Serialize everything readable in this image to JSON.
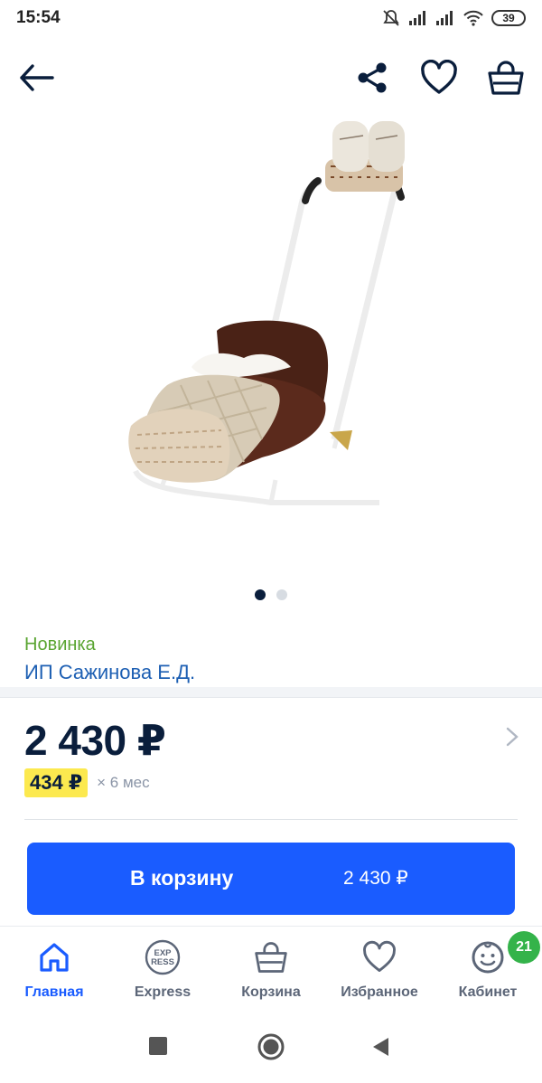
{
  "status_bar": {
    "time": "15:54",
    "battery": "39"
  },
  "product": {
    "badge": "Новинка",
    "seller": "ИП Сажинова Е.Д.",
    "price": "2 430 ₽",
    "installment_amount": "434 ₽",
    "installment_term": "× 6 мес",
    "gallery_pages": 2,
    "gallery_current": 1
  },
  "buy_button": {
    "label": "В корзину",
    "price": "2 430 ₽"
  },
  "bottom_nav": {
    "tabs": [
      {
        "label": "Главная",
        "icon": "home-icon",
        "active": true
      },
      {
        "label": "Express",
        "icon": "express-icon",
        "active": false
      },
      {
        "label": "Корзина",
        "icon": "basket-icon",
        "active": false
      },
      {
        "label": "Избранное",
        "icon": "heart-icon",
        "active": false
      },
      {
        "label": "Кабинет",
        "icon": "profile-icon",
        "active": false
      }
    ],
    "cabinet_badge": "21"
  },
  "express_logo_text": [
    "EXP",
    "RESS"
  ],
  "colors": {
    "accent": "#1a5cff",
    "new_badge": "#5aa532",
    "seller_link": "#1d5fb3",
    "installment_bg": "#fce94f",
    "notification": "#34b34a"
  }
}
